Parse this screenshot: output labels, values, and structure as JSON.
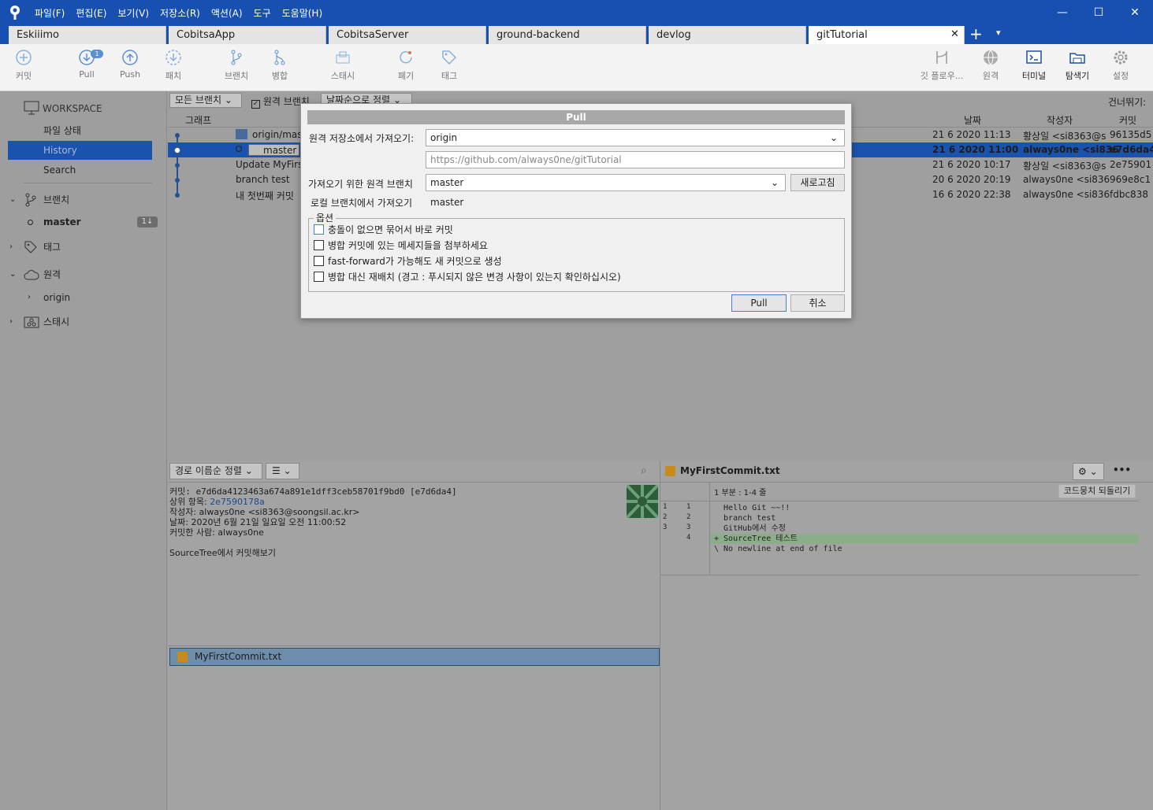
{
  "app": {
    "menu": [
      "파일(F)",
      "편집(E)",
      "보기(V)",
      "저장소(R)",
      "액션(A)",
      "도구",
      "도움말(H)"
    ],
    "window": {
      "minimize": "—",
      "maximize": "☐",
      "close": "✕"
    }
  },
  "tabs": [
    "Eskiiimo",
    "CobitsaApp",
    "CobitsaServer",
    "ground-backend",
    "devlog",
    "gitTutorial"
  ],
  "tab_close": "✕",
  "tab_add": "+",
  "tab_menu": "▾",
  "toolbar": {
    "commit": "커밋",
    "pull": "Pull",
    "pull_badge": "1",
    "push": "Push",
    "fetch": "패치",
    "branch": "브랜치",
    "merge": "병합",
    "stash": "스태시",
    "discard": "폐기",
    "tag": "태그",
    "gitflow": "깃 플로우...",
    "remote": "원격",
    "terminal": "터미널",
    "explorer": "탐색기",
    "settings": "설정"
  },
  "sidebar": {
    "workspace": "WORKSPACE",
    "file_status": "파일 상태",
    "history": "History",
    "search": "Search",
    "branches": "브랜치",
    "master": "master",
    "master_badge": "1↓",
    "tags": "태그",
    "remotes": "원격",
    "origin": "origin",
    "stashes": "스태시"
  },
  "main": {
    "branch_filter": "모든 브랜치",
    "remote_branch": "원격 브랜치",
    "sort": "날짜순으로 정렬",
    "jump": "건너뛰기:",
    "col_graph": "그래프",
    "col_date": "날짜",
    "col_author": "작성자",
    "col_commit": "커밋",
    "rows": [
      {
        "desc": "origin/maste",
        "date": "21 6 2020 11:13",
        "author": "황상일 <si8363@s",
        "hash": "96135d5"
      },
      {
        "desc": "master",
        "date": "21 6 2020 11:00",
        "author": "always0ne <si836",
        "hash": "e7d6da4"
      },
      {
        "desc": "Update MyFirst",
        "date": "21 6 2020 10:17",
        "author": "황상일 <si8363@s",
        "hash": "2e75901"
      },
      {
        "desc": "branch test",
        "date": "20 6 2020 20:19",
        "author": "always0ne <si836",
        "hash": "969e8c1"
      },
      {
        "desc": "내 첫번째 커밋",
        "date": "16 6 2020 22:38",
        "author": "always0ne <si836",
        "hash": "fdbc838"
      }
    ]
  },
  "details": {
    "sort_path": "경로 이름순 정렬",
    "list_icon": "☰",
    "search_icon": "⌕",
    "commit_line": "커밋: e7d6da4123463a674a891e1dff3ceb58701f9bd0 [e7d6da4]",
    "parent_label": "상위 항목:",
    "parent_hash": "2e7590178a",
    "author_line": "작성자: always0ne <si8363@soongsil.ac.kr>",
    "date_line": "날짜: 2020년 6월 21일 일요일 오전 11:00:52",
    "committer_line": "커밋한 사람: always0ne",
    "message": "SourceTree에서 커밋해보기",
    "file": "MyFirstCommit.txt"
  },
  "diff": {
    "file": "MyFirstCommit.txt",
    "hunk": "1 부분 : 1-4 줄",
    "revert": "코드뭉치 되돌리기",
    "more": "•••",
    "lines": [
      {
        "old": "1",
        "new": "1",
        "text": "  Hello Git ~~!!"
      },
      {
        "old": "2",
        "new": "2",
        "text": "  branch test"
      },
      {
        "old": "3",
        "new": "3",
        "text": "  GitHub에서 수정"
      },
      {
        "old": "",
        "new": "4",
        "text": "+ SourceTree 테스트"
      },
      {
        "old": "",
        "new": "",
        "text": "\\ No newline at end of file"
      }
    ]
  },
  "dialog": {
    "title": "Pull",
    "remote_label": "원격 저장소에서 가져오기:",
    "remote_value": "origin",
    "url": "https://github.com/always0ne/gitTutorial",
    "branch_label": "가져오기 위한 원격 브랜치",
    "branch_value": "master",
    "refresh": "새로고침",
    "local_label": "로컬 브랜치에서 가져오기",
    "local_value": "master",
    "options_label": "옵션",
    "options": [
      "충돌이 없으면 묶어서 바로 커밋",
      "병합 커밋에 있는 메세지들을 첨부하세요",
      "fast-forward가 가능해도 새 커밋으로 생성",
      "병합 대신 재배치 (경고 : 푸시되지 않은 변경 사항이 있는지 확인하십시오)"
    ],
    "ok": "Pull",
    "cancel": "취소"
  }
}
